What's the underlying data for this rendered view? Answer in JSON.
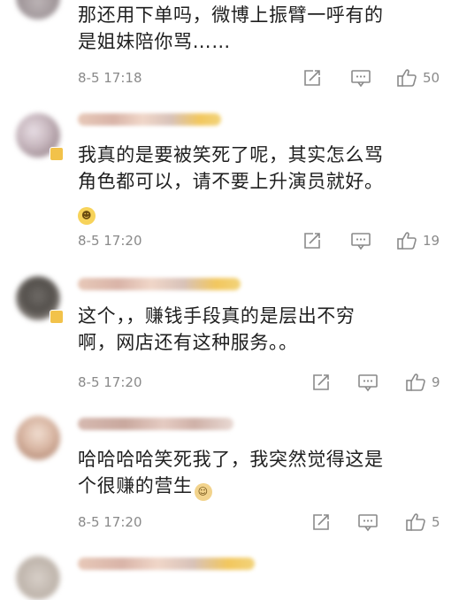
{
  "comments": [
    {
      "text_line1": "那还用下单吗，微博上振臂一呼有的",
      "text_line2": "是姐妹陪你骂……",
      "time": "8-5 17:18",
      "likes": "50"
    },
    {
      "text_line1": "我真的是要被笑死了呢，其实怎么骂",
      "text_line2": "角色都可以，请不要上升演员就好。",
      "emoji": "laughing-emoji",
      "time": "8-5 17:20",
      "likes": "19"
    },
    {
      "text_line1": "这个，，赚钱手段真的是层出不穷",
      "text_line2": "啊，网店还有这种服务。。",
      "time": "8-5 17:20",
      "likes": "9"
    },
    {
      "text_line1": "哈哈哈哈笑死我了，我突然觉得这是",
      "text_line2": "个很赚的营生",
      "emoji": "doge-emoji",
      "time": "8-5 17:20",
      "likes": "5"
    }
  ],
  "colors": {
    "text": "#1f1f1f",
    "meta": "#8a8a8a",
    "badge": "#f2c24a"
  }
}
